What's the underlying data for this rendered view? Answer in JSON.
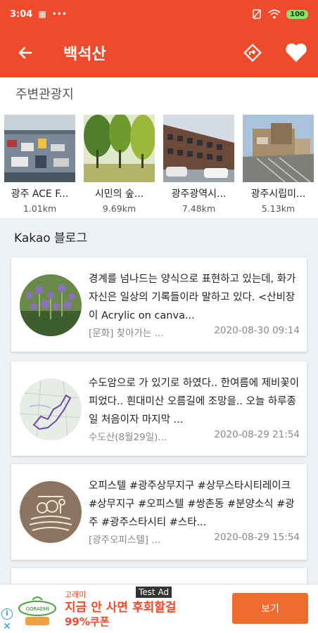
{
  "status_bar": {
    "time": "3:04",
    "battery": "100"
  },
  "header": {
    "title": "백석산"
  },
  "nearby": {
    "title": "주변관광지",
    "items": [
      {
        "name": "광주 ACE F...",
        "distance": "1.01km"
      },
      {
        "name": "시민의 숲...",
        "distance": "9.69km"
      },
      {
        "name": "광주광역시...",
        "distance": "7.48km"
      },
      {
        "name": "광주시립미...",
        "distance": "5.13km"
      }
    ]
  },
  "blog": {
    "title": "Kakao 블로그",
    "posts": [
      {
        "excerpt": "경계를 넘나드는 양식으로 표현하고 있는데, 화가 자신은 일상의 기록들이라 말하고 있다. <산비장이 Acrylic on canva...",
        "source": "[문화] 찾아가는 ...",
        "date": "2020-08-30 09:14"
      },
      {
        "excerpt": "수도암으로 가 있기로 하였다.. 한여름에 제비꽃이 피었다.. 흰대미산 오름길에 조망을.. 오늘 하루종일 처음이자 마지막 ...",
        "source": "수도산(8월29일)...",
        "date": "2020-08-29 21:54"
      },
      {
        "excerpt": "오피스텔 #광주상무지구 #상무스타시티레이크 #상무지구 #오피스텔 #쌍촌동 #분양소식 #광주 #광주스타시티 #스타...",
        "source": "[광주오피스텔] ...",
        "date": "2020-08-29 15:54"
      }
    ]
  },
  "ad": {
    "label": "Test Ad",
    "brand": "고래미",
    "headline": "지금 안 사면 후회할걸",
    "coupon": "99%쿠폰",
    "logo_text": "GORAEMI",
    "button": "보기"
  }
}
